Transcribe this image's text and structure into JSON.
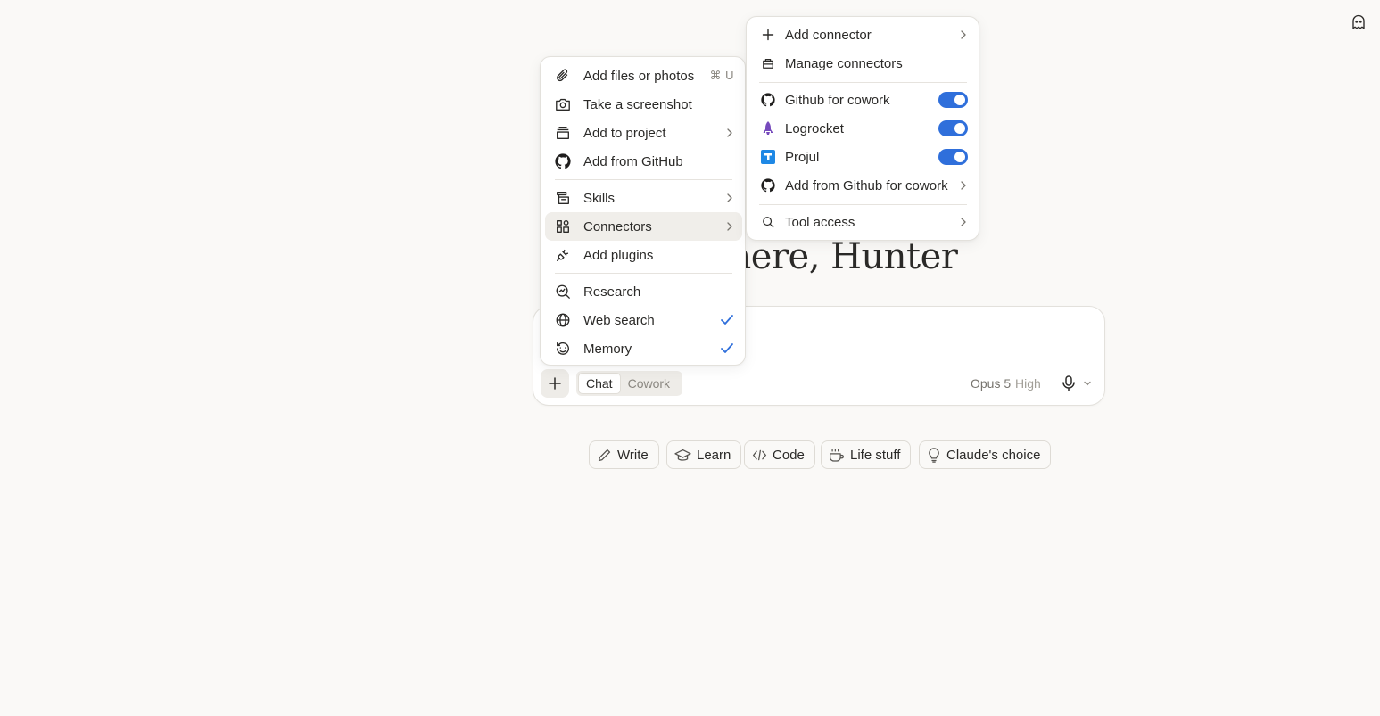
{
  "greeting": "y there, Hunter",
  "composer": {
    "mode_options": [
      "Chat",
      "Cowork"
    ],
    "active_mode": "Chat",
    "model_name": "Opus 5",
    "model_effort": "High"
  },
  "chips": [
    {
      "label": "Write",
      "icon": "pencil-icon"
    },
    {
      "label": "Learn",
      "icon": "graduation-cap-icon"
    },
    {
      "label": "Code",
      "icon": "code-icon"
    },
    {
      "label": "Life stuff",
      "icon": "coffee-cup-icon"
    },
    {
      "label": "Claude's choice",
      "icon": "lightbulb-icon"
    }
  ],
  "attach_menu": {
    "items": [
      {
        "label": "Add files or photos",
        "icon": "paperclip-icon",
        "shortcut": "⌘ U"
      },
      {
        "label": "Take a screenshot",
        "icon": "camera-icon"
      },
      {
        "label": "Add to project",
        "icon": "project-icon",
        "submenu": true
      },
      {
        "label": "Add from GitHub",
        "icon": "github-icon"
      },
      {
        "label": "Skills",
        "icon": "skills-icon",
        "submenu": true
      },
      {
        "label": "Connectors",
        "icon": "connectors-icon",
        "submenu": true,
        "highlighted": true
      },
      {
        "label": "Add plugins",
        "icon": "plug-icon"
      },
      {
        "label": "Research",
        "icon": "research-icon"
      },
      {
        "label": "Web search",
        "icon": "globe-icon",
        "checked": true
      },
      {
        "label": "Memory",
        "icon": "memory-icon",
        "checked": true
      }
    ]
  },
  "connectors_menu": {
    "items": [
      {
        "label": "Add connector",
        "icon": "plus-icon",
        "submenu": true
      },
      {
        "label": "Manage connectors",
        "icon": "briefcase-icon"
      },
      {
        "label": "Github for cowork",
        "icon": "github-icon",
        "enabled": true
      },
      {
        "label": "Logrocket",
        "icon": "logrocket-icon",
        "enabled": true
      },
      {
        "label": "Projul",
        "icon": "projul-icon",
        "enabled": true
      },
      {
        "label": "Add from Github for cowork",
        "icon": "github-icon",
        "submenu": true
      },
      {
        "label": "Tool access",
        "icon": "search-icon",
        "submenu": true
      }
    ]
  },
  "colors": {
    "background": "#faf9f7",
    "toggle_on": "#2f6fdb",
    "check": "#2f6fdb",
    "logrocket": "#764abc",
    "projul": "#1e88e5"
  }
}
